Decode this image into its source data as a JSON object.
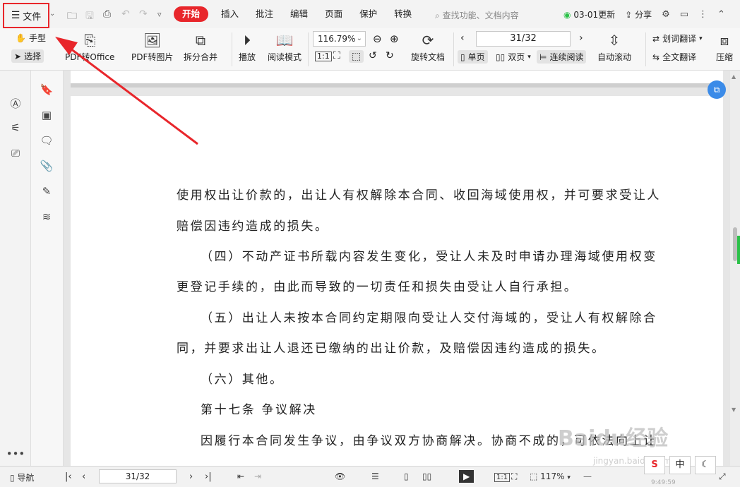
{
  "menubar": {
    "file_label": "文件",
    "tabs": [
      "开始",
      "插入",
      "批注",
      "编辑",
      "页面",
      "保护",
      "转换"
    ],
    "search_placeholder": "查找功能、文档内容",
    "update_label": "03-01更新",
    "share_label": "分享"
  },
  "toolbar": {
    "hand_label": "手型",
    "select_label": "选择",
    "pdf_to_office": "PDF转Office",
    "pdf_to_image": "PDF转图片",
    "split_merge": "拆分合并",
    "play": "播放",
    "read_mode": "阅读模式",
    "zoom_value": "116.79%",
    "rotate_doc": "旋转文档",
    "page_value": "31/32",
    "single_page": "单页",
    "double_page": "双页",
    "continuous_read": "连续阅读",
    "auto_scroll": "自动滚动",
    "word_translate": "划词翻译",
    "full_translate": "全文翻译",
    "compress": "压缩"
  },
  "document": {
    "lines": [
      "使用权出让价款的，出让人有权解除本合同、收回海域使用权，并可要求受让人",
      "赔偿因违约造成的损失。",
      "（四）不动产证书所载内容发生变化，受让人未及时申请办理海域使用权变",
      "更登记手续的，由此而导致的一切责任和损失由受让人自行承担。",
      "（五）出让人未按本合同约定期限向受让人交付海域的，受让人有权解除合",
      "同，并要求出让人退还已缴纳的出让价款，及赔偿因违约造成的损失。",
      "（六）其他。",
      "第十七条   争议解决",
      "因履行本合同发生争议，由争议双方协商解决。协商不成的，可依法向上让"
    ]
  },
  "statusbar": {
    "nav_label": "导航",
    "page_value": "31/32",
    "zoom_value": "117%",
    "time_partial": "9:49:59"
  },
  "watermark": {
    "brand": "Baidu经验",
    "url": "jingyan.baidu.com"
  },
  "ime": {
    "mode": "中"
  },
  "colors": {
    "accent": "#e8262b",
    "annotation": "#e8262b"
  }
}
